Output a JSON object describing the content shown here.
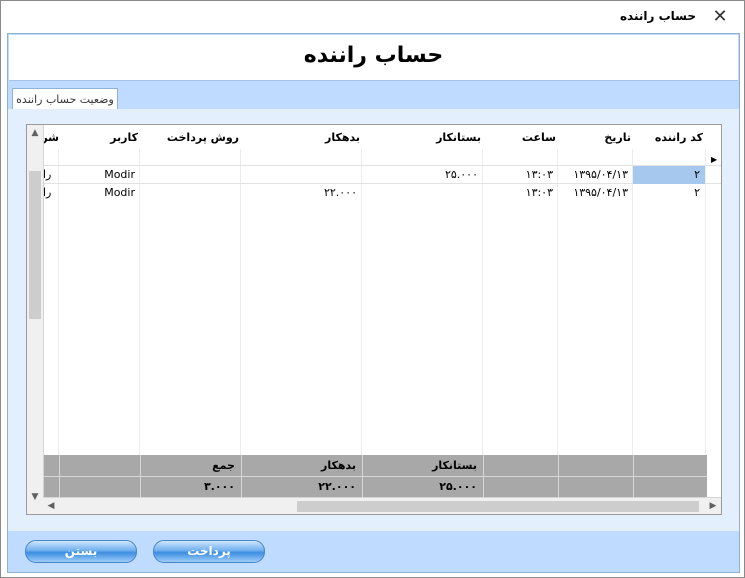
{
  "window": {
    "title": "حساب راننده",
    "close_glyph": "✕"
  },
  "header": {
    "title": "حساب راننده"
  },
  "tab": {
    "label": "وضعیت حساب راننده"
  },
  "grid": {
    "columns": [
      "کد راننده",
      "تاریخ",
      "ساعت",
      "بستانکار",
      "بدهکار",
      "روش پرداخت",
      "کاربر",
      "شر"
    ],
    "rows": [
      {
        "driver_code": "۲",
        "date": "۱۳۹۵/۰۴/۱۳",
        "time": "۱۳:۰۳",
        "credit": "۲۵.۰۰۰",
        "debit": "",
        "payment_method": "",
        "user": "Modir",
        "desc": "را"
      },
      {
        "driver_code": "۲",
        "date": "۱۳۹۵/۰۴/۱۳",
        "time": "۱۳:۰۳",
        "credit": "",
        "debit": "۲۲.۰۰۰",
        "payment_method": "",
        "user": "Modir",
        "desc": "را"
      }
    ],
    "selected_row_indicator": "▶",
    "summary": {
      "labels": {
        "credit": "بستانکار",
        "debit": "بدهکار",
        "sum": "جمع"
      },
      "values": {
        "credit": "۲۵.۰۰۰",
        "debit": "۲۲.۰۰۰",
        "sum": "۳.۰۰۰"
      }
    }
  },
  "buttons": {
    "pay": "پرداخت",
    "close": "بستن"
  }
}
